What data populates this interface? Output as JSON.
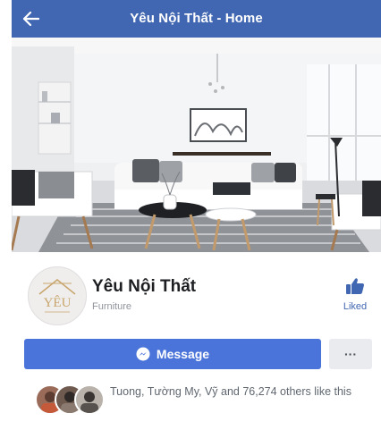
{
  "navbar": {
    "title": "Yêu Nội Thất - Home",
    "back_icon": "arrow-left-icon"
  },
  "cover": {
    "description_icon": "cover-photo"
  },
  "page": {
    "name": "Yêu Nội Thất",
    "category": "Furniture",
    "avatar_text": "YÊU",
    "liked_label": "Liked"
  },
  "actions": {
    "message_label": "Message",
    "more_label": "···"
  },
  "likers": {
    "text": "Tuong, Tường My, Vỹ and 76,274 others like this"
  },
  "colors": {
    "brand": "#4267b2",
    "message_button": "#4a74d9",
    "liked": "#4267b2"
  }
}
